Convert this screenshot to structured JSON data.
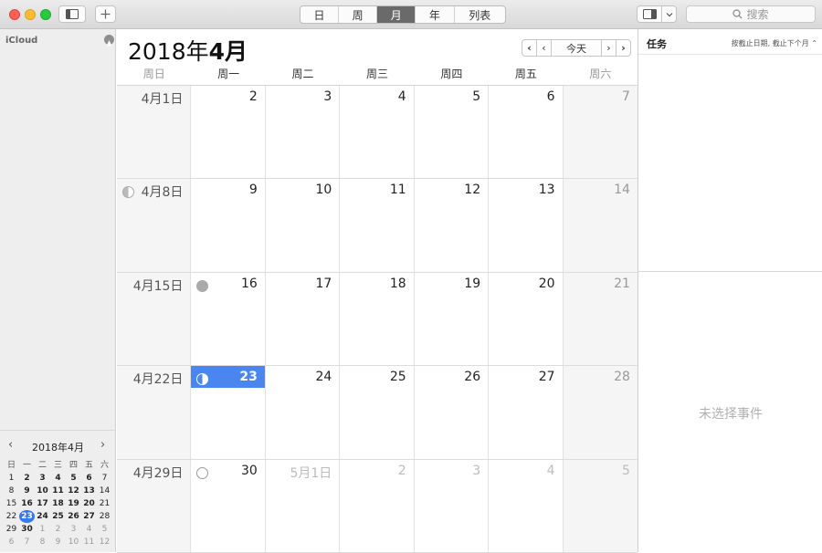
{
  "toolbar": {
    "view_tabs": [
      "日",
      "周",
      "月",
      "年",
      "列表"
    ],
    "active_tab": 2,
    "search_placeholder": "搜索"
  },
  "sidebar": {
    "account": "iCloud"
  },
  "mini_calendar": {
    "title": "2018年4月",
    "weekdays": [
      "日",
      "一",
      "二",
      "三",
      "四",
      "五",
      "六"
    ],
    "days": [
      [
        "1",
        "2",
        "3",
        "4",
        "5",
        "6",
        "7"
      ],
      [
        "8",
        "9",
        "10",
        "11",
        "12",
        "13",
        "14"
      ],
      [
        "15",
        "16",
        "17",
        "18",
        "19",
        "20",
        "21"
      ],
      [
        "22",
        "23",
        "24",
        "25",
        "26",
        "27",
        "28"
      ],
      [
        "29",
        "30",
        "1",
        "2",
        "3",
        "4",
        "5"
      ],
      [
        "6",
        "7",
        "8",
        "9",
        "10",
        "11",
        "12"
      ]
    ],
    "today": "23"
  },
  "calendar": {
    "title_year": "2018年",
    "title_month": "4月",
    "today_button": "今天",
    "weekdays": [
      "周日",
      "周一",
      "周二",
      "周三",
      "周四",
      "周五",
      "周六"
    ],
    "weeks": [
      [
        "4月1日",
        "2",
        "3",
        "4",
        "5",
        "6",
        "7"
      ],
      [
        "4月8日",
        "9",
        "10",
        "11",
        "12",
        "13",
        "14"
      ],
      [
        "4月15日",
        "16",
        "17",
        "18",
        "19",
        "20",
        "21"
      ],
      [
        "4月22日",
        "23",
        "24",
        "25",
        "26",
        "27",
        "28"
      ],
      [
        "4月29日",
        "30",
        "5月1日",
        "2",
        "3",
        "4",
        "5"
      ]
    ],
    "selected_day": "23",
    "moon_phases": {
      "4月8日": "last-quarter",
      "16": "new",
      "23": "first-quarter",
      "30": "full"
    }
  },
  "tasks": {
    "title": "任务",
    "sort_label": "按截止日期, 截止下个月"
  },
  "inspector": {
    "empty_text": "未选择事件"
  },
  "colors": {
    "accent": "#3478f6",
    "selection": "#4b86ef"
  }
}
